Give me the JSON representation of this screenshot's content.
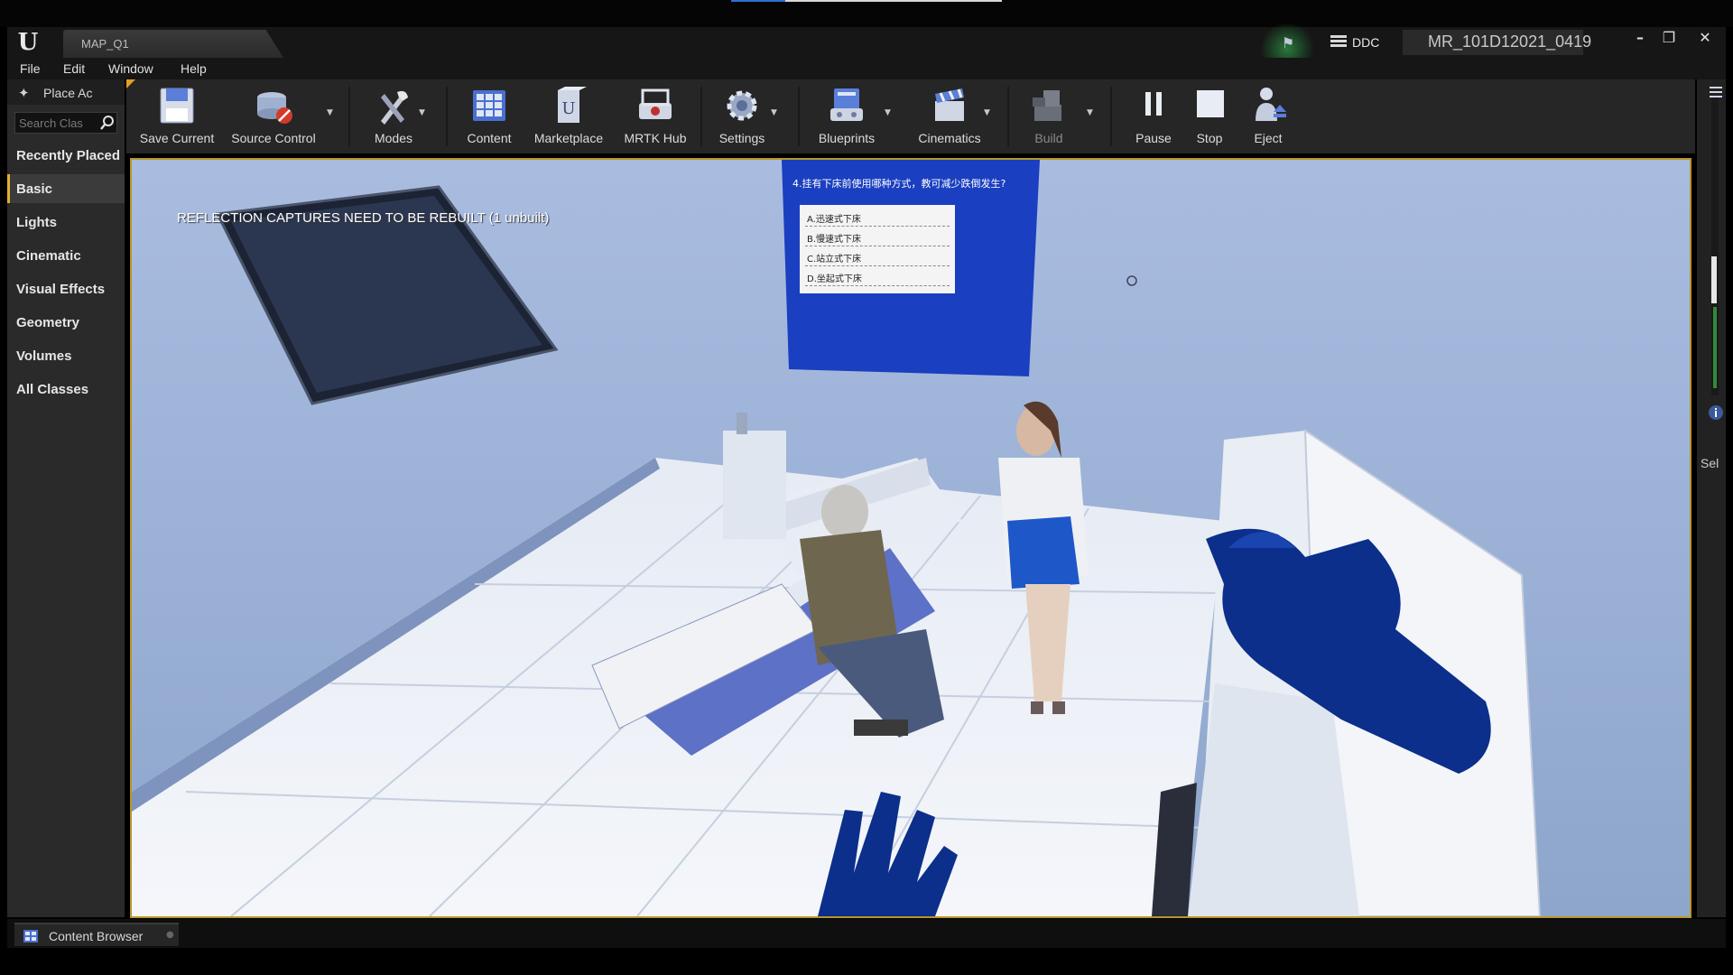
{
  "window": {
    "tab_title": "MAP_Q1",
    "source_control_status": "DDC",
    "project_name": "MR_101D12021_0419",
    "controls": {
      "minimize": "–",
      "restore": "❐",
      "close": "✕"
    }
  },
  "menu": [
    "File",
    "Edit",
    "Window",
    "Help"
  ],
  "place_actors": {
    "tab_label": "Place Ac",
    "search_placeholder": "Search Clas",
    "categories": [
      "Recently Placed",
      "Basic",
      "Lights",
      "Cinematic",
      "Visual Effects",
      "Geometry",
      "Volumes",
      "All Classes"
    ],
    "active_category": "Basic"
  },
  "toolbar": {
    "save": "Save Current",
    "source_control": "Source Control",
    "modes": "Modes",
    "content": "Content",
    "marketplace": "Marketplace",
    "mrtk_hub": "MRTK Hub",
    "settings": "Settings",
    "blueprints": "Blueprints",
    "cinematics": "Cinematics",
    "build": "Build",
    "pause": "Pause",
    "stop": "Stop",
    "eject": "Eject"
  },
  "viewport": {
    "warning": "REFLECTION CAPTURES NEED TO BE REBUILT (1 unbuilt)",
    "quiz_question": "4.挂有下床前使用哪种方式，教可减少跌倒发生?",
    "quiz_options": [
      "A.迅速式下床",
      "B.慢速式下床",
      "C.站立式下床",
      "D.坐起式下床"
    ]
  },
  "right_panel": {
    "label": "Sel"
  },
  "bottom": {
    "content_browser": "Content Browser"
  },
  "colors": {
    "accent": "#e0b030",
    "quiz_board": "#1a3fc0",
    "vr_hand": "#0b2f8a",
    "viewport_bg": "#97acd2"
  }
}
